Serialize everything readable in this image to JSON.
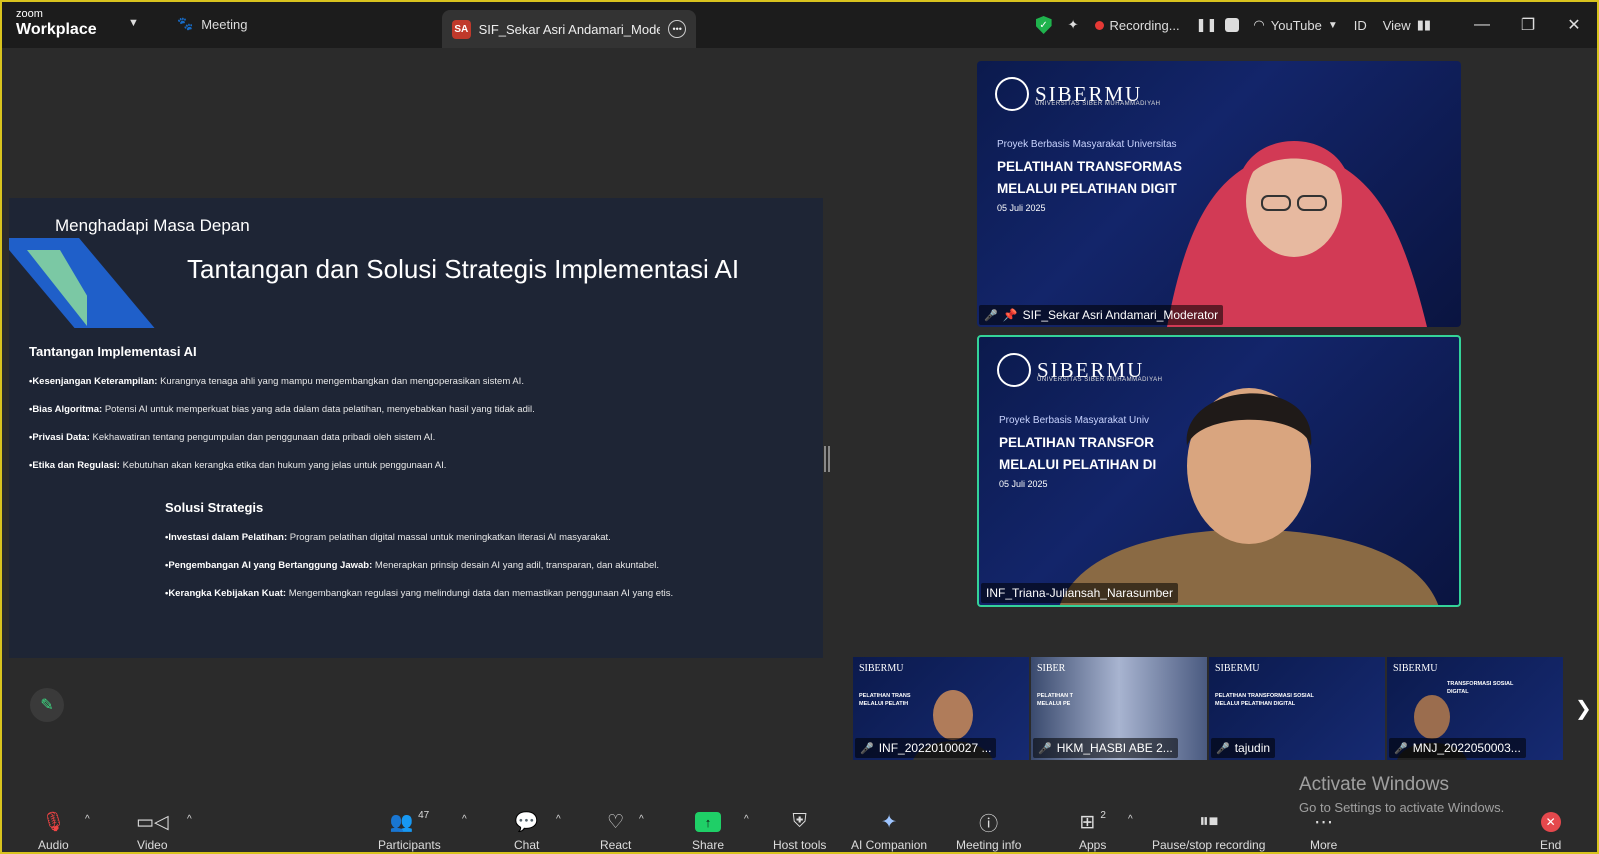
{
  "app": {
    "logo_line1": "zoom",
    "logo_line2": "Workplace"
  },
  "tabs": {
    "meeting": "Meeting",
    "active_badge": "SA",
    "active_title": "SIF_Sekar Asri Andamari_Moderator"
  },
  "top_right": {
    "recording": "Recording...",
    "youtube": "YouTube",
    "lang": "ID",
    "view": "View"
  },
  "slide": {
    "subtitle": "Menghadapi Masa Depan",
    "title": "Tantangan dan Solusi Strategis Implementasi AI",
    "section1": {
      "heading": "Tantangan Implementasi AI",
      "points": [
        {
          "bold": "•Kesenjangan Keterampilan:",
          "text": " Kurangnya tenaga ahli yang mampu mengembangkan dan mengoperasikan sistem AI."
        },
        {
          "bold": "•Bias Algoritma:",
          "text": " Potensi AI untuk memperkuat bias yang ada dalam data pelatihan, menyebabkan hasil yang tidak adil."
        },
        {
          "bold": "•Privasi Data:",
          "text": " Kekhawatiran tentang pengumpulan dan penggunaan data pribadi oleh sistem AI."
        },
        {
          "bold": "•Etika dan Regulasi:",
          "text": " Kebutuhan akan kerangka etika dan hukum yang jelas untuk penggunaan AI."
        }
      ]
    },
    "section2": {
      "heading": "Solusi Strategis",
      "points": [
        {
          "bold": "•Investasi dalam Pelatihan:",
          "text": " Program pelatihan digital massal untuk meningkatkan literasi AI masyarakat."
        },
        {
          "bold": "•Pengembangan AI yang Bertanggung Jawab:",
          "text": " Menerapkan prinsip desain AI yang adil, transparan, dan akuntabel."
        },
        {
          "bold": "•Kerangka Kebijakan Kuat:",
          "text": " Mengembangkan regulasi yang melindungi data dan memastikan penggunaan AI yang etis."
        }
      ]
    }
  },
  "video_bg": {
    "logo": "SIBERMU",
    "logo_sub": "UNIVERSITAS SIBER MUHAMMADIYAH",
    "project_full": "Proyek Berbasis Masyarakat Universitas",
    "project_cut": "Proyek Berbasis Masyarakat Univ",
    "line1_a": "PELATIHAN TRANSFORMAS",
    "line2_a": "MELALUI PELATIHAN DIGIT",
    "line1_b": "PELATIHAN TRANSFOR",
    "line2_b": "MELALUI PELATIHAN DI",
    "date": "05 Juli 2025"
  },
  "videos": [
    {
      "name": "SIF_Sekar Asri Andamari_Moderator"
    },
    {
      "name": "INF_Triana-Juliansah_Narasumber"
    }
  ],
  "thumbs": [
    {
      "name": "INF_20220100027 ...",
      "logo": "SIBERMU",
      "t1": "PELATIHAN TRANS",
      "t2": "MELALUI PELATIH"
    },
    {
      "name": "HKM_HASBI ABE  2...",
      "logo": "SIBER",
      "t1": "PELATIHAN T",
      "t2": "MELALUI PE"
    },
    {
      "name": "tajudin",
      "logo": "SIBERMU",
      "t1": "PELATIHAN TRANSFORMASI SOSIAL",
      "t2": "MELALUI PELATIHAN DIGITAL"
    },
    {
      "name": "MNJ_2022050003...",
      "logo": "SIBERMU",
      "t1": "TRANSFORMASI SOSIAL",
      "t2": "DIGITAL"
    }
  ],
  "activate": {
    "line1": "Activate Windows",
    "line2": "Go to Settings to activate Windows."
  },
  "toolbar": {
    "audio": "Audio",
    "video": "Video",
    "participants": "Participants",
    "participants_count": "47",
    "chat": "Chat",
    "react": "React",
    "share": "Share",
    "host_tools": "Host tools",
    "ai_companion": "AI Companion",
    "meeting_info": "Meeting info",
    "apps": "Apps",
    "apps_count": "2",
    "pause_stop": "Pause/stop recording",
    "more": "More",
    "end": "End"
  }
}
